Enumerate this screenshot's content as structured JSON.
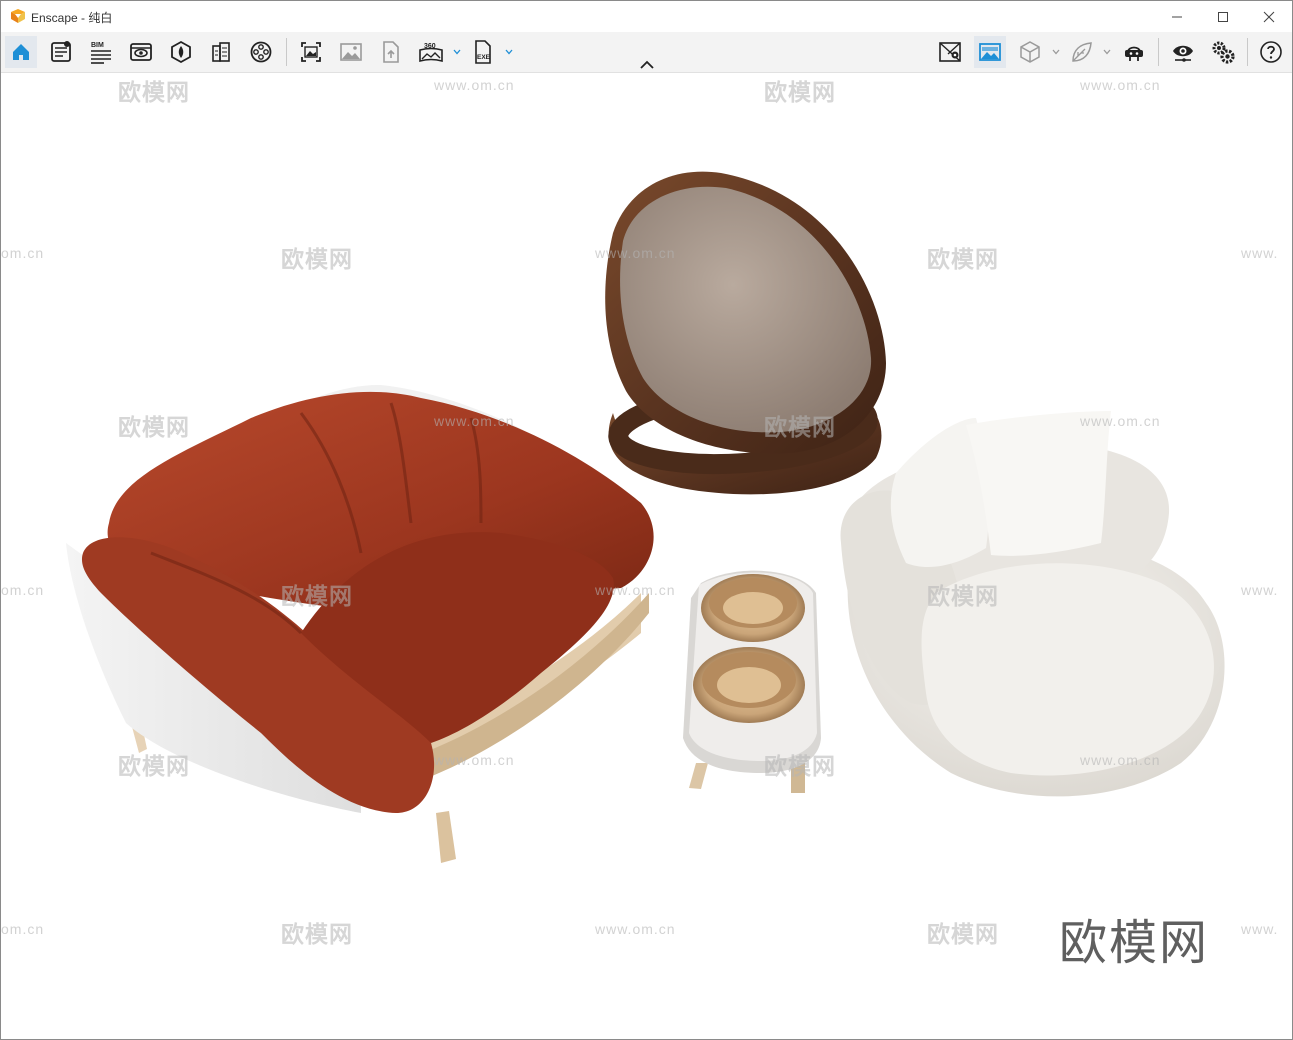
{
  "window": {
    "app_name": "Enscape",
    "title": "Enscape - 纯白"
  },
  "toolbar": {
    "left_items": [
      {
        "name": "home",
        "icon": "home-icon",
        "active": true
      },
      {
        "name": "asset-library",
        "icon": "asset-library-icon"
      },
      {
        "name": "bim",
        "icon": "bim-icon",
        "label": "BIM"
      },
      {
        "name": "views",
        "icon": "views-icon"
      },
      {
        "name": "material-editor",
        "icon": "material-editor-icon"
      },
      {
        "name": "site-context",
        "icon": "building-icon"
      },
      {
        "name": "video-editor",
        "icon": "video-reel-icon"
      },
      {
        "name": "screenshot",
        "icon": "screenshot-icon"
      },
      {
        "name": "batch-render",
        "icon": "image-gallery-icon"
      },
      {
        "name": "upload",
        "icon": "upload-file-icon"
      },
      {
        "name": "panorama",
        "icon": "panorama-icon",
        "label": "360"
      },
      {
        "name": "export-exe",
        "icon": "export-exe-icon",
        "label": "EXE"
      }
    ],
    "right_items": [
      {
        "name": "map",
        "icon": "map-icon"
      },
      {
        "name": "atmosphere",
        "icon": "atmosphere-icon",
        "active": true
      },
      {
        "name": "cube",
        "icon": "cube-icon"
      },
      {
        "name": "leaf",
        "icon": "leaf-icon"
      },
      {
        "name": "vr",
        "icon": "vr-headset-icon"
      },
      {
        "name": "visual-settings",
        "icon": "eye-icon"
      },
      {
        "name": "general-settings",
        "icon": "gears-icon"
      },
      {
        "name": "help",
        "icon": "help-icon"
      }
    ]
  },
  "viewport": {
    "watermark_text": "欧模网",
    "watermark_url": "www.om.cn",
    "watermark_url_short": "om.cn",
    "watermark_url_prefix": "www.",
    "brand_mark": "欧模网"
  },
  "colors": {
    "accent": "#1e8fd6",
    "leather": "#a13a22",
    "wood_dark": "#5a3420",
    "fabric_taupe": "#a8988c",
    "boucle": "#eeebe6",
    "ply": "#dcc6a6"
  }
}
